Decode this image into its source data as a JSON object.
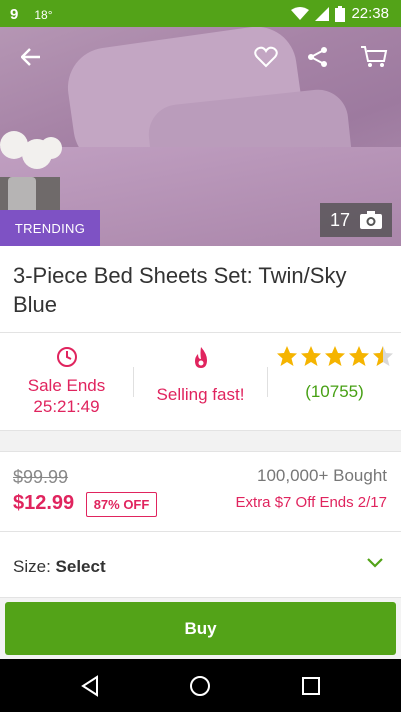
{
  "status_bar": {
    "notification_icon": "g-icon",
    "temperature": "18°",
    "time": "22:38"
  },
  "hero": {
    "badge": "TRENDING",
    "photo_count": "17"
  },
  "product": {
    "title": "3-Piece Bed Sheets Set: Twin/Sky Blue"
  },
  "stats": {
    "sale_label": "Sale Ends",
    "sale_timer": "25:21:49",
    "selling_label": "Selling fast!",
    "rating": 4.5,
    "rating_count": "(10755)"
  },
  "pricing": {
    "old_price": "$99.99",
    "new_price": "$12.99",
    "discount": "87% OFF",
    "bought": "100,000+ Bought",
    "extra_offer": "Extra $7 Off Ends 2/17"
  },
  "size": {
    "label": "Size:",
    "value": "Select"
  },
  "actions": {
    "buy_label": "Buy"
  },
  "colors": {
    "brand_green": "#53a318",
    "accent_pink": "#e0245e",
    "trending_purple": "#7e52c4",
    "star_yellow": "#f5b400"
  }
}
